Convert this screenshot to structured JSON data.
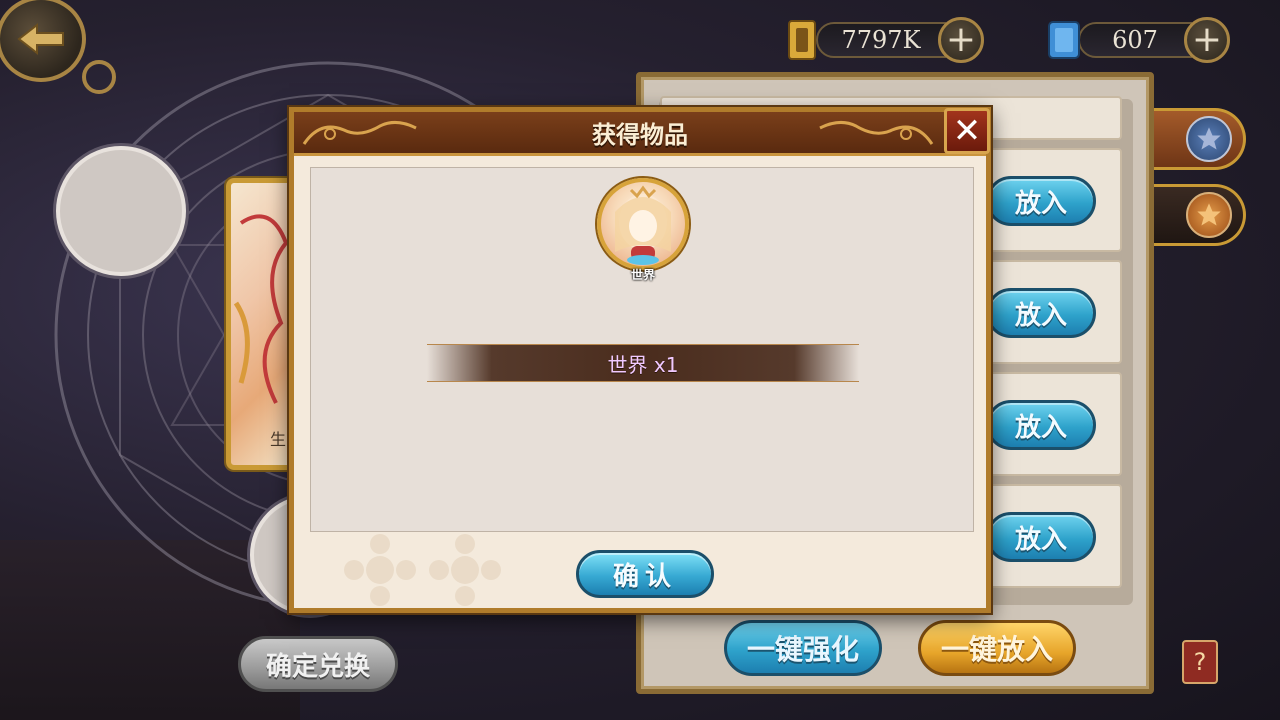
{
  "currencies": {
    "gold": {
      "value": "7797K",
      "icon": "gold-bar-icon",
      "color": "#d9a93a"
    },
    "gem": {
      "value": "607",
      "icon": "blue-crystal-icon",
      "color": "#3f8fd6"
    }
  },
  "plus_label": "+",
  "right_panel": {
    "put_buttons": [
      "放入",
      "放入",
      "放入",
      "放入"
    ],
    "one_click_enhance": "一键强化",
    "one_click_put": "一键放入",
    "help_label": "?"
  },
  "left": {
    "card_label": "生",
    "confirm_exchange": "确定兑换"
  },
  "modal": {
    "title": "获得物品",
    "close_label": "✕",
    "item_small_name": "世界",
    "reward_text": "世界 x1",
    "confirm_label": "确认"
  },
  "colors": {
    "accent_gold": "#b07c2b",
    "button_blue": "#2ea2cb",
    "button_gold": "#e7a52a",
    "reward_text": "#f0c9ff"
  }
}
